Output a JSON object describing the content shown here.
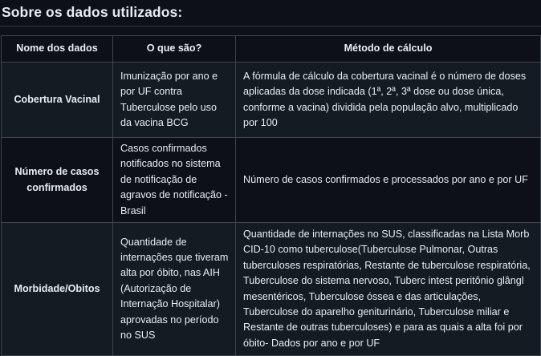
{
  "section": {
    "title": "Sobre os dados utilizados:"
  },
  "table": {
    "headers": [
      "Nome dos dados",
      "O que são?",
      "Método de cálculo"
    ],
    "rows": [
      {
        "name": "Cobertura Vacinal",
        "what": "Imunização por ano e por UF contra Tuberculose pelo uso da vacina BCG",
        "method": "A fórmula de cálculo da cobertura vacinal é o número de doses aplicadas da dose indicada (1ª, 2ª, 3ª dose ou dose única, conforme a vacina) dividida pela população alvo, multiplicado por 100"
      },
      {
        "name": "Número de casos confirmados",
        "what": "Casos confirmados notificados no sistema de notificação de agravos de notificação - Brasil",
        "method": "Número de casos confirmados e processados por ano e por UF"
      },
      {
        "name": "Morbidade/Obitos",
        "what": "Quantidade de internações que tiveram alta por óbito, nas AIH (Autorização de Internação Hospitalar) aprovadas no período no SUS",
        "method": "Quantidade de internações no SUS, classificadas na Lista Morb CID-10 como tuberculose(Tuberculose Pulmonar, Outras tuberculoses respiratórias, Restante de tuberculose respiratória, Tuberculose do sistema nervoso, Tuberc intest peritônio glângl mesentéricos, Tuberculose óssea e das articulações, Tuberculose do aparelho geniturinário, Tuberculose miliar e Restante de outras tuberculoses) e para as quais a alta foi por óbito- Dados por ano e por UF"
      }
    ]
  }
}
